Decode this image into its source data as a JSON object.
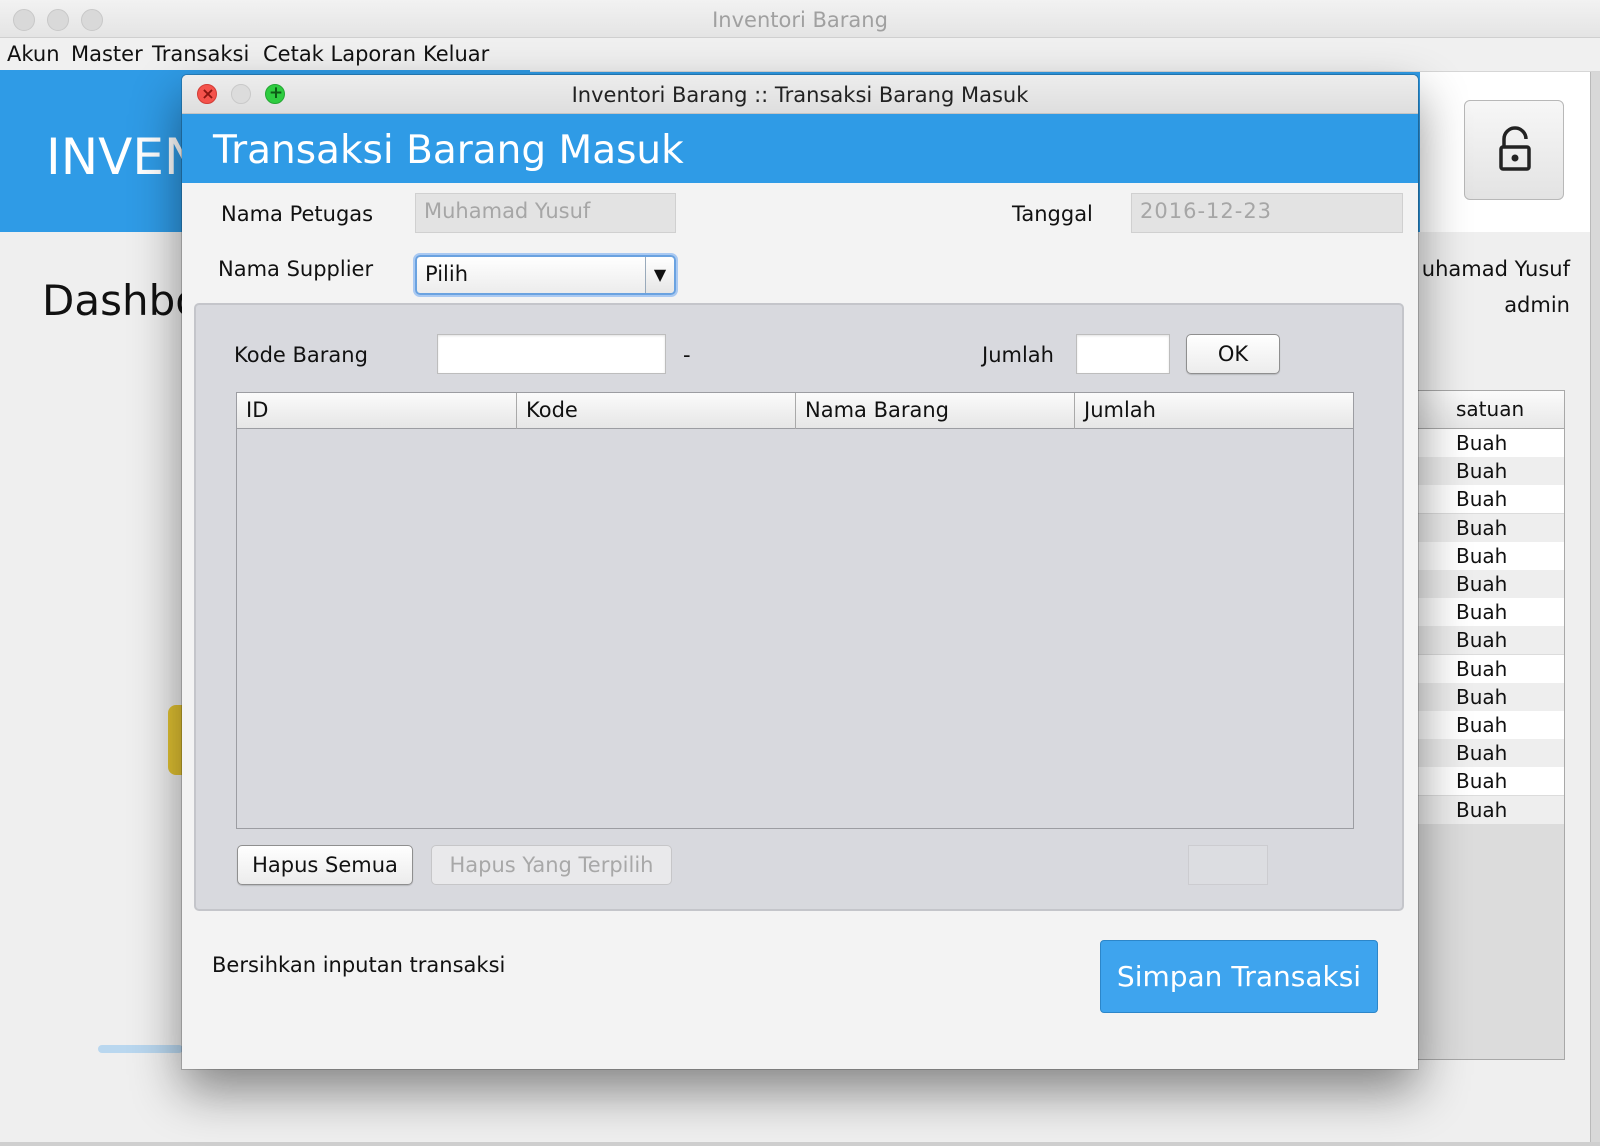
{
  "main_window": {
    "title": "Inventori Barang",
    "menu": [
      "Akun",
      "Master",
      "Transaksi",
      "Cetak Laporan",
      "Keluar"
    ],
    "app_title": "INVEN",
    "page_heading": "Dashbo",
    "user_name": "uhamad Yusuf",
    "user_role": "admin",
    "table_header": "satuan",
    "table_rows": [
      "Buah",
      "Buah",
      "Buah",
      "Buah",
      "Buah",
      "Buah",
      "Buah",
      "Buah",
      "Buah",
      "Buah",
      "Buah",
      "Buah",
      "Buah",
      "Buah"
    ],
    "lock_icon": "lock-icon"
  },
  "dialog": {
    "title": "Inventori Barang :: Transaksi Barang Masuk",
    "heading": "Transaksi Barang Masuk",
    "petugas_label": "Nama Petugas",
    "petugas_value": "Muhamad Yusuf",
    "tanggal_label": "Tanggal",
    "tanggal_value": "2016-12-23",
    "supplier_label": "Nama Supplier",
    "supplier_selected": "Pilih",
    "kode_label": "Kode Barang",
    "kode_value": "",
    "kode_separator": "-",
    "jumlah_label": "Jumlah",
    "jumlah_value": "",
    "ok_label": "OK",
    "table_columns": [
      "ID",
      "Kode",
      "Nama Barang",
      "Jumlah"
    ],
    "hapus_semua_label": "Hapus Semua",
    "hapus_terpilih_label": "Hapus Yang Terpilih",
    "total_value": "",
    "clear_link": "Bersihkan inputan transaksi",
    "simpan_label": "Simpan Transaksi"
  },
  "colors": {
    "accent": "#2f9be6",
    "save_button": "#3ea4ee",
    "close_dot": "#f4524b",
    "max_dot": "#2ecc40"
  }
}
